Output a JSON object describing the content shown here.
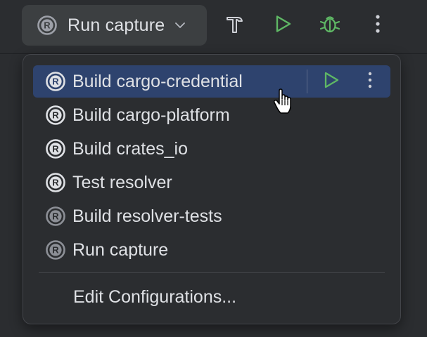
{
  "toolbar": {
    "config_label": "Run capture",
    "config_icon": "rust-icon",
    "build_icon": "hammer-icon",
    "run_icon": "run-icon",
    "debug_icon": "debug-icon",
    "more_icon": "more-vertical-icon"
  },
  "menu": {
    "items": [
      {
        "label": "Build cargo-credential",
        "selected": true,
        "dimmed": false
      },
      {
        "label": "Build cargo-platform",
        "selected": false,
        "dimmed": false
      },
      {
        "label": "Build crates_io",
        "selected": false,
        "dimmed": false
      },
      {
        "label": "Test resolver",
        "selected": false,
        "dimmed": false
      },
      {
        "label": "Build resolver-tests",
        "selected": false,
        "dimmed": true
      },
      {
        "label": "Run capture",
        "selected": false,
        "dimmed": true
      }
    ],
    "edit_label": "Edit Configurations..."
  },
  "colors": {
    "background": "#2b2d30",
    "selector": "#3c3f41",
    "selection": "#2e436e",
    "text": "#dfe1e5",
    "run_green": "#5fb865",
    "debug_green": "#5fb865"
  }
}
